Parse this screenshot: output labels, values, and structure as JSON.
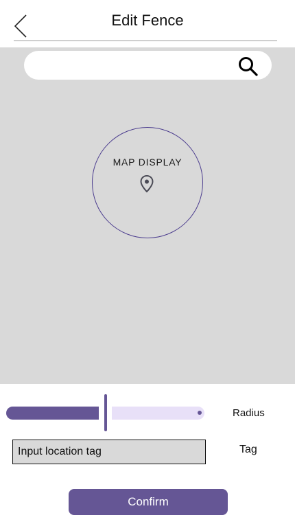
{
  "header": {
    "title": "Edit Fence",
    "back_icon": "chevron-left-icon"
  },
  "map": {
    "search": {
      "value": "",
      "placeholder": "",
      "icon": "search-icon"
    },
    "placeholder_label": "MAP DISPLAY",
    "pin_icon": "location-pin-icon"
  },
  "radius": {
    "label": "Radius",
    "level_fraction": 0.5
  },
  "tag": {
    "label": "Tag",
    "placeholder": "Input location tag",
    "value": ""
  },
  "confirm": {
    "label": "Confirm"
  },
  "colors": {
    "accent": "#655695",
    "accent_light": "#e8e0f8",
    "map_background": "#d9d9d9",
    "circle_border": "#4b3c8e"
  }
}
